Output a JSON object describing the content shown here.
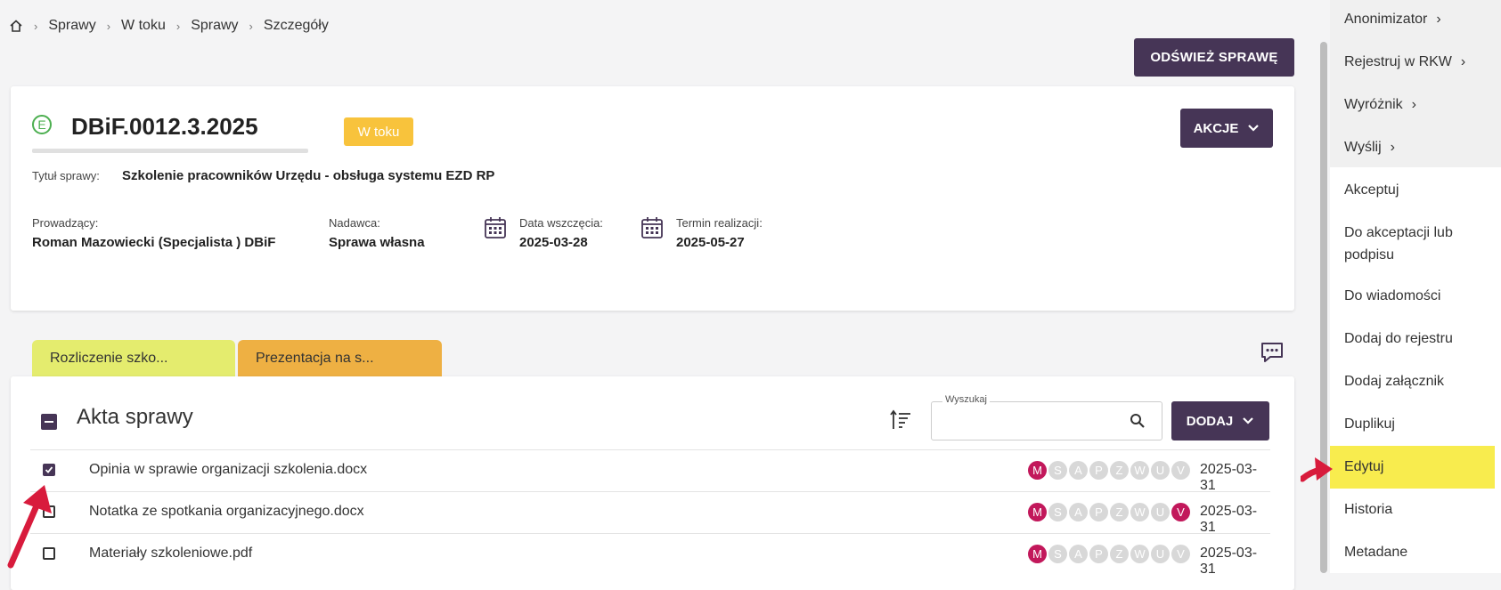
{
  "breadcrumb": [
    "Sprawy",
    "W toku",
    "Sprawy",
    "Szczegóły"
  ],
  "header": {
    "refresh_label": "ODŚWIEŻ SPRAWĘ"
  },
  "case": {
    "type_letter": "E",
    "number": "DBiF.0012.3.2025",
    "status": "W toku",
    "actions_label": "AKCJE",
    "title_label": "Tytuł sprawy:",
    "title_value": "Szkolenie pracowników Urzędu - obsługa systemu EZD RP",
    "leader_label": "Prowadzący:",
    "leader_value": "Roman Mazowiecki (Specjalista ) DBiF",
    "sender_label": "Nadawca:",
    "sender_value": "Sprawa własna",
    "start_label": "Data wszczęcia:",
    "start_value": "2025-03-28",
    "deadline_label": "Termin realizacji:",
    "deadline_value": "2025-05-27"
  },
  "tabs": [
    {
      "label": "Rozliczenie szko...",
      "color": "#e4ec6e"
    },
    {
      "label": "Prezentacja na s...",
      "color": "#eeb043"
    }
  ],
  "files": {
    "title": "Akta sprawy",
    "search_label": "Wyszukaj",
    "add_label": "DODAJ",
    "letters": [
      "M",
      "S",
      "A",
      "P",
      "Z",
      "W",
      "U",
      "V"
    ],
    "rows": [
      {
        "name": "Opinia w sprawie organizacji szkolenia.docx",
        "date": "2025-03-31",
        "checked": true,
        "active": [
          "M"
        ]
      },
      {
        "name": "Notatka ze spotkania organizacyjnego.docx",
        "date": "2025-03-31",
        "checked": false,
        "active": [
          "M",
          "V"
        ]
      },
      {
        "name": "Materiały szkoleniowe.pdf",
        "date": "2025-03-31",
        "checked": false,
        "active": [
          "M"
        ]
      }
    ]
  },
  "menu": {
    "items": [
      {
        "label": "Anonimizator",
        "sub": true
      },
      {
        "label": "Rejestruj w RKW",
        "sub": true
      },
      {
        "label": "Wyróżnik",
        "sub": true
      },
      {
        "label": "Wyślij",
        "sub": true
      },
      {
        "label": "Akceptuj",
        "sub": false
      },
      {
        "label": "Do akceptacji lub podpisu",
        "sub": false
      },
      {
        "label": "Do wiadomości",
        "sub": false
      },
      {
        "label": "Dodaj do rejestru",
        "sub": false
      },
      {
        "label": "Dodaj załącznik",
        "sub": false
      },
      {
        "label": "Duplikuj",
        "sub": false
      },
      {
        "label": "Edytuj",
        "sub": false,
        "highlighted": true
      },
      {
        "label": "Historia",
        "sub": false
      },
      {
        "label": "Metadane",
        "sub": false
      }
    ]
  },
  "colors": {
    "primary": "#463556",
    "badge": "#f8c33c",
    "highlight": "#f8ec4e",
    "active_circle": "#c2185b",
    "arrow": "#d81b3c"
  }
}
